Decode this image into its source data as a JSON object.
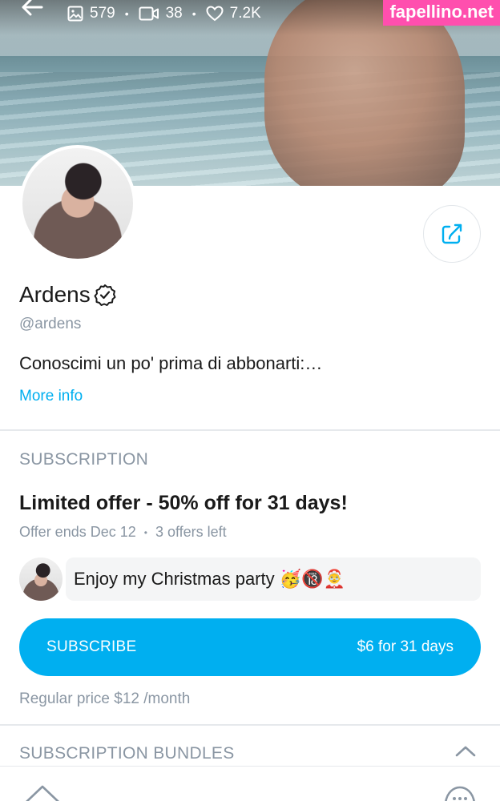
{
  "header": {
    "stats": {
      "photos": "579",
      "videos": "38",
      "likes": "7.2K"
    },
    "watermark": "fapellino.net"
  },
  "profile": {
    "name": "Ardens",
    "handle": "@ardens",
    "bio": "Conoscimi un po' prima di abbonarti:…",
    "more_info": "More info"
  },
  "subscription": {
    "section_title": "SUBSCRIPTION",
    "offer_title": "Limited offer - 50% off for 31 days!",
    "offer_ends": "Offer ends Dec 12",
    "offers_left": "3 offers left",
    "message": "Enjoy my Christmas party 🥳🔞🤶",
    "button_label": "SUBSCRIBE",
    "button_price": "$6 for 31 days",
    "regular_price": "Regular price $12 /month"
  },
  "bundles": {
    "section_title": "SUBSCRIPTION BUNDLES"
  },
  "colors": {
    "accent": "#00aff0",
    "muted_text": "#8a96a3",
    "watermark_bg": "#ff4fae"
  },
  "icons": {
    "back": "back-arrow-icon",
    "photos": "image-icon",
    "videos": "video-icon",
    "likes": "heart-icon",
    "verified": "verified-badge-icon",
    "share": "share-icon",
    "bundles_toggle": "chevron-up-icon",
    "nav_home": "home-icon",
    "nav_more": "more-icon"
  }
}
